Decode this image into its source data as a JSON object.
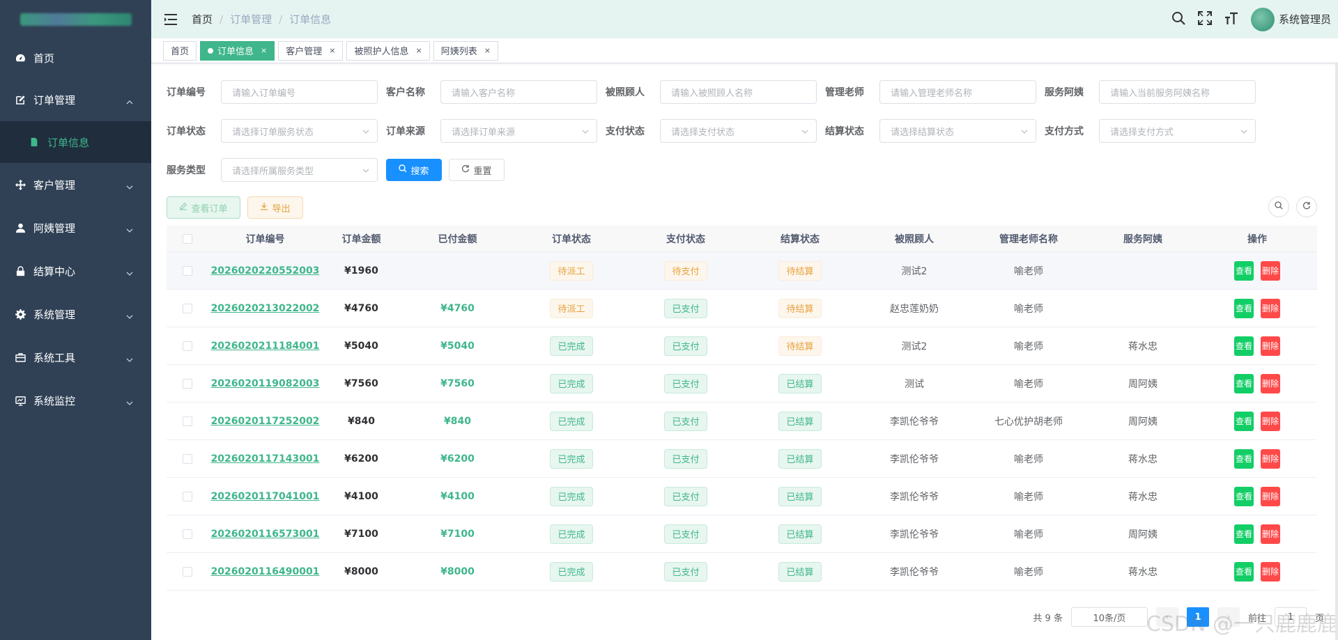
{
  "sidebar": {
    "items": [
      {
        "label": "首页",
        "icon": "dashboard-icon"
      },
      {
        "label": "订单管理",
        "icon": "edit-icon",
        "expanded": true
      },
      {
        "label": "订单信息",
        "icon": "document-icon",
        "active": true
      },
      {
        "label": "客户管理",
        "icon": "move-icon"
      },
      {
        "label": "阿姨管理",
        "icon": "user-icon"
      },
      {
        "label": "结算中心",
        "icon": "lock-icon"
      },
      {
        "label": "系统管理",
        "icon": "gear-icon"
      },
      {
        "label": "系统工具",
        "icon": "toolbox-icon"
      },
      {
        "label": "系统监控",
        "icon": "monitor-icon"
      }
    ]
  },
  "header": {
    "breadcrumb": [
      "首页",
      "订单管理",
      "订单信息"
    ],
    "user_name": "系统管理员"
  },
  "tags": [
    {
      "label": "首页",
      "closable": false,
      "active": false
    },
    {
      "label": "订单信息",
      "closable": true,
      "active": true
    },
    {
      "label": "客户管理",
      "closable": true,
      "active": false
    },
    {
      "label": "被照护人信息",
      "closable": true,
      "active": false
    },
    {
      "label": "阿姨列表",
      "closable": true,
      "active": false
    }
  ],
  "search": {
    "fields": [
      {
        "label": "订单编号",
        "placeholder": "请输入订单编号",
        "type": "input"
      },
      {
        "label": "客户名称",
        "placeholder": "请输入客户名称",
        "type": "input"
      },
      {
        "label": "被照顾人",
        "placeholder": "请输入被照顾人名称",
        "type": "input"
      },
      {
        "label": "管理老师",
        "placeholder": "请输入管理老师名称",
        "type": "input"
      },
      {
        "label": "服务阿姨",
        "placeholder": "请输入当前服务阿姨名称",
        "type": "input"
      },
      {
        "label": "订单状态",
        "placeholder": "请选择订单服务状态",
        "type": "select"
      },
      {
        "label": "订单来源",
        "placeholder": "请选择订单来源",
        "type": "select"
      },
      {
        "label": "支付状态",
        "placeholder": "请选择支付状态",
        "type": "select"
      },
      {
        "label": "结算状态",
        "placeholder": "请选择结算状态",
        "type": "select"
      },
      {
        "label": "支付方式",
        "placeholder": "请选择支付方式",
        "type": "select"
      },
      {
        "label": "服务类型",
        "placeholder": "请选择所属服务类型",
        "type": "select"
      }
    ],
    "search_label": "搜索",
    "reset_label": "重置"
  },
  "toolbar": {
    "view_label": "查看订单",
    "export_label": "导出"
  },
  "table": {
    "columns": [
      "订单编号",
      "订单金额",
      "已付金额",
      "订单状态",
      "支付状态",
      "结算状态",
      "被照顾人",
      "管理老师名称",
      "服务阿姨",
      "操作"
    ],
    "view_label": "查看",
    "delete_label": "删除",
    "rows": [
      {
        "order_no": "2026020220552003",
        "amount": "¥1960",
        "paid": "",
        "order_status": "待派工",
        "order_status_type": "warn",
        "pay_status": "待支付",
        "pay_status_type": "warn",
        "settle_status": "待结算",
        "settle_status_type": "warn",
        "care": "测试2",
        "manager": "喻老师",
        "ayi": ""
      },
      {
        "order_no": "2026020213022002",
        "amount": "¥4760",
        "paid": "¥4760",
        "order_status": "待派工",
        "order_status_type": "warn",
        "pay_status": "已支付",
        "pay_status_type": "ok",
        "settle_status": "待结算",
        "settle_status_type": "warn",
        "care": "赵忠莲奶奶",
        "manager": "喻老师",
        "ayi": ""
      },
      {
        "order_no": "2026020211184001",
        "amount": "¥5040",
        "paid": "¥5040",
        "order_status": "已完成",
        "order_status_type": "ok",
        "pay_status": "已支付",
        "pay_status_type": "ok",
        "settle_status": "待结算",
        "settle_status_type": "warn",
        "care": "测试2",
        "manager": "喻老师",
        "ayi": "蒋水忠"
      },
      {
        "order_no": "2026020119082003",
        "amount": "¥7560",
        "paid": "¥7560",
        "order_status": "已完成",
        "order_status_type": "ok",
        "pay_status": "已支付",
        "pay_status_type": "ok",
        "settle_status": "已结算",
        "settle_status_type": "ok",
        "care": "测试",
        "manager": "喻老师",
        "ayi": "周阿姨"
      },
      {
        "order_no": "2026020117252002",
        "amount": "¥840",
        "paid": "¥840",
        "order_status": "已完成",
        "order_status_type": "ok",
        "pay_status": "已支付",
        "pay_status_type": "ok",
        "settle_status": "已结算",
        "settle_status_type": "ok",
        "care": "李凯伦爷爷",
        "manager": "七心优护胡老师",
        "ayi": "周阿姨"
      },
      {
        "order_no": "2026020117143001",
        "amount": "¥6200",
        "paid": "¥6200",
        "order_status": "已完成",
        "order_status_type": "ok",
        "pay_status": "已支付",
        "pay_status_type": "ok",
        "settle_status": "已结算",
        "settle_status_type": "ok",
        "care": "李凯伦爷爷",
        "manager": "喻老师",
        "ayi": "蒋水忠"
      },
      {
        "order_no": "2026020117041001",
        "amount": "¥4100",
        "paid": "¥4100",
        "order_status": "已完成",
        "order_status_type": "ok",
        "pay_status": "已支付",
        "pay_status_type": "ok",
        "settle_status": "已结算",
        "settle_status_type": "ok",
        "care": "李凯伦爷爷",
        "manager": "喻老师",
        "ayi": "蒋水忠"
      },
      {
        "order_no": "2026020116573001",
        "amount": "¥7100",
        "paid": "¥7100",
        "order_status": "已完成",
        "order_status_type": "ok",
        "pay_status": "已支付",
        "pay_status_type": "ok",
        "settle_status": "已结算",
        "settle_status_type": "ok",
        "care": "李凯伦爷爷",
        "manager": "喻老师",
        "ayi": "周阿姨"
      },
      {
        "order_no": "2026020116490001",
        "amount": "¥8000",
        "paid": "¥8000",
        "order_status": "已完成",
        "order_status_type": "ok",
        "pay_status": "已支付",
        "pay_status_type": "ok",
        "settle_status": "已结算",
        "settle_status_type": "ok",
        "care": "李凯伦爷爷",
        "manager": "喻老师",
        "ayi": "蒋水忠"
      }
    ]
  },
  "pagination": {
    "total_text": "共 9 条",
    "page_size": "10条/页",
    "current_page": "1",
    "goto_prefix": "前往",
    "goto_value": "1",
    "goto_suffix": "页"
  },
  "watermark": "CSDN @一只鹿鹿鹿",
  "colors": {
    "sidebar_bg": "#304156",
    "accent": "#3fb68b",
    "primary": "#1890ff",
    "danger": "#ff4949",
    "success": "#13ce66",
    "warning": "#e6a23c"
  }
}
